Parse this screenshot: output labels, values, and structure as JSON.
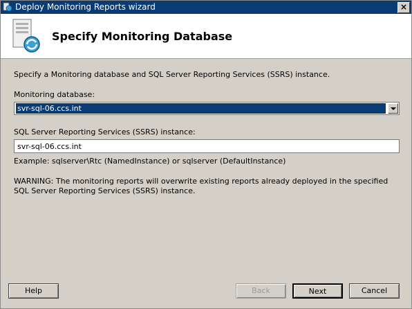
{
  "window": {
    "title": "Deploy Monitoring Reports wizard",
    "close_label": "×"
  },
  "header": {
    "title": "Specify Monitoring Database"
  },
  "intro_text": "Specify a Monitoring database and SQL Server Reporting Services (SSRS) instance.",
  "monitoring_db": {
    "label": "Monitoring database:",
    "selected": "svr-sql-06.ccs.int"
  },
  "ssrs": {
    "label": "SQL Server Reporting Services (SSRS) instance:",
    "value": "svr-sql-06.ccs.int"
  },
  "example_text": "Example: sqlserver\\Rtc (NamedInstance) or sqlserver (DefaultInstance)",
  "warning_text": "WARNING: The monitoring reports will overwrite existing reports already deployed in the specified SQL Server Reporting Services (SSRS) instance.",
  "buttons": {
    "help": "Help",
    "back": "Back",
    "next": "Next",
    "cancel": "Cancel"
  },
  "colors": {
    "titlebar": "#0b3b73",
    "selection": "#0b3b73",
    "face": "#d4d0c8"
  }
}
